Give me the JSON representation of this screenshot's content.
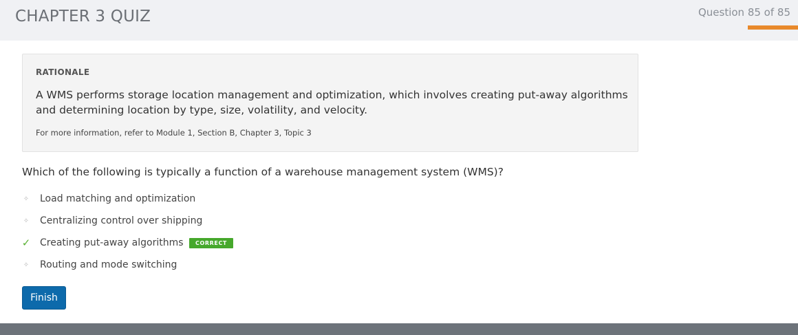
{
  "header": {
    "title": "CHAPTER 3 QUIZ",
    "counter": "Question 85 of 85",
    "progress": 1.0,
    "progress_color": "#e8892b"
  },
  "rationale": {
    "heading": "RATIONALE",
    "text": "A WMS performs storage location management and optimization, which involves creating put-away algorithms and determining location by type, size, volatility, and velocity.",
    "reference": "For more information, refer to Module 1, Section B, Chapter 3, Topic 3"
  },
  "question": {
    "text": "Which of the following is typically a function of a warehouse management system (WMS)?"
  },
  "answers": [
    {
      "label": "Load matching and optimization",
      "marker": "bullet-icon"
    },
    {
      "label": "Centralizing control over shipping",
      "marker": "bullet-icon"
    },
    {
      "label": "Creating put-away algorithms",
      "marker": "checkmark-icon",
      "badge": "CORRECT"
    },
    {
      "label": "Routing and mode switching",
      "marker": "bullet-icon"
    }
  ],
  "actions": {
    "finish_label": "Finish"
  },
  "colors": {
    "correct": "#46a82c",
    "button": "#0d6aab",
    "footer": "#6d737a"
  }
}
